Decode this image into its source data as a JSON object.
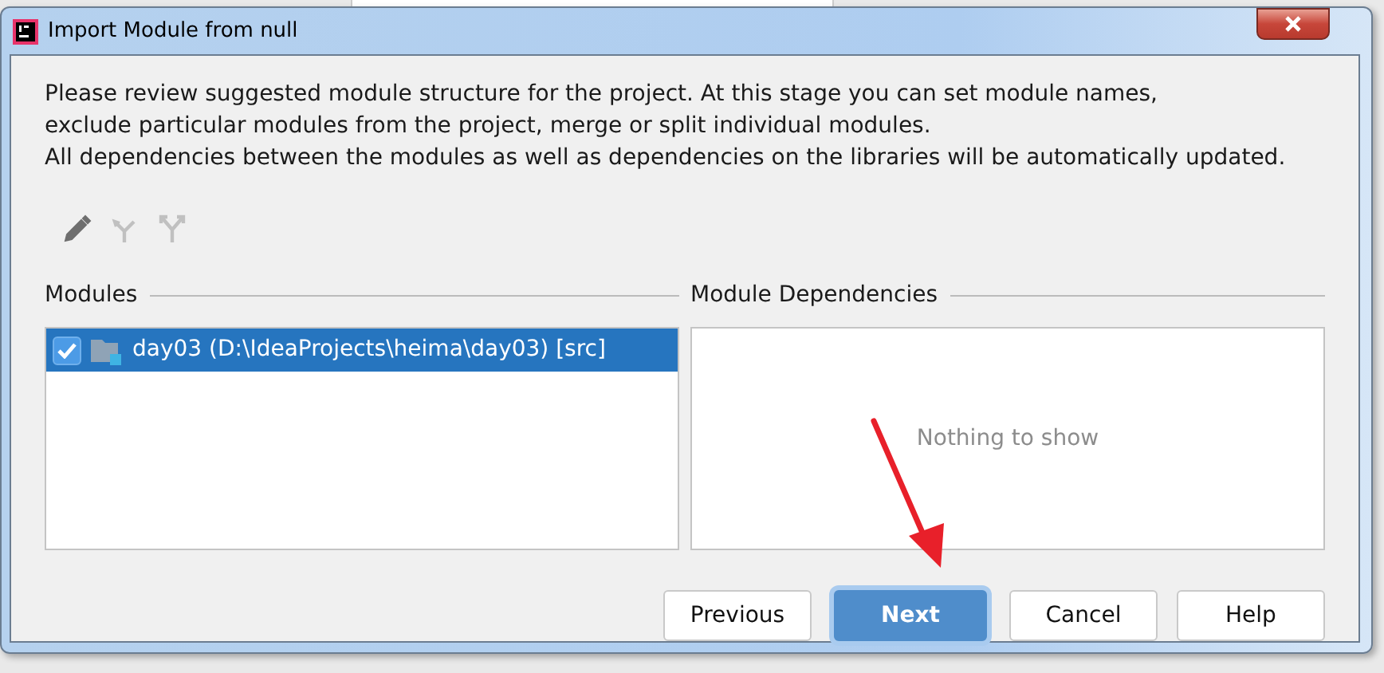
{
  "window": {
    "title": "Import Module from null"
  },
  "description": [
    "Please review suggested module structure for the project. At this stage you can set module names,",
    "exclude particular modules from the project, merge or split individual modules.",
    "All dependencies between the modules as well as dependencies on the libraries will be automatically updated."
  ],
  "toolbar": [
    {
      "kind": "rename",
      "disabled": false
    },
    {
      "kind": "merge",
      "disabled": true
    },
    {
      "kind": "split",
      "disabled": true
    }
  ],
  "modules": {
    "title": "Modules",
    "items": [
      {
        "label": "day03 (D:\\IdeaProjects\\heima\\day03) [src]",
        "checked": true,
        "selected": true
      }
    ]
  },
  "dependencies": {
    "title": "Module Dependencies",
    "empty_text": "Nothing to show"
  },
  "buttons": [
    {
      "label": "Previous",
      "default": false
    },
    {
      "label": "Next",
      "default": true
    },
    {
      "label": "Cancel",
      "default": false
    },
    {
      "label": "Help",
      "default": false
    }
  ]
}
